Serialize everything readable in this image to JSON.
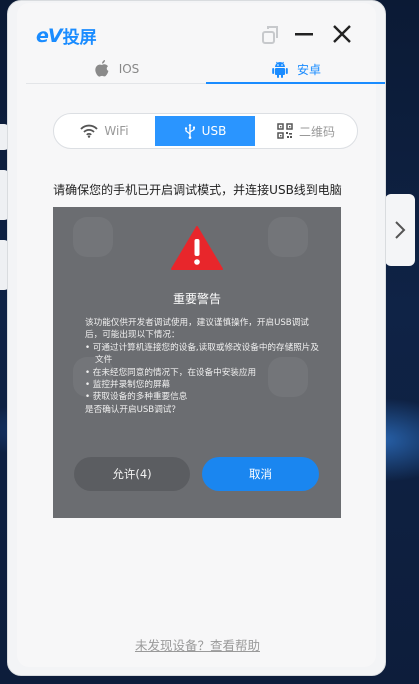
{
  "app": {
    "logo_ev": "eV",
    "logo_text": "投屏"
  },
  "os_tabs": [
    {
      "label": "IOS",
      "active": false,
      "icon": "apple-icon"
    },
    {
      "label": "安卓",
      "active": true,
      "icon": "android-icon"
    }
  ],
  "connection_modes": [
    {
      "label": "WiFi",
      "active": false,
      "icon": "wifi-icon"
    },
    {
      "label": "USB",
      "active": true,
      "icon": "usb-icon"
    },
    {
      "label": "二维码",
      "active": false,
      "icon": "qrcode-icon"
    }
  ],
  "instruction": "请确保您的手机已开启调试模式，并连接USB线到电脑",
  "dialog": {
    "title": "重要警告",
    "lines": [
      "该功能仅供开发者调试使用，建议谨慎操作，开启USB调试后，可能出现以下情况：",
      "• 可通过计算机连接您的设备,读取或修改设备中的存储照片及文件",
      "• 在未经您同意的情况下，在设备中安装应用",
      "• 监控并录制您的屏幕",
      "• 获取设备的多种重要信息",
      "是否确认开启USB调试？"
    ],
    "allow_label": "允许(4)",
    "cancel_label": "取消"
  },
  "help_link": "未发现设备？查看帮助",
  "colors": {
    "accent": "#1a8cff",
    "warning": "#e8262b"
  }
}
